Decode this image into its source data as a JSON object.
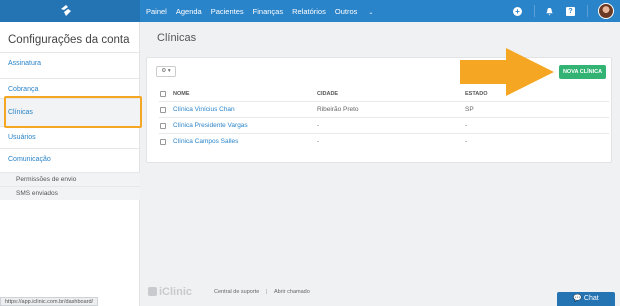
{
  "nav": {
    "items": [
      "Painel",
      "Agenda",
      "Pacientes",
      "Finanças",
      "Relatórios",
      "Outros"
    ],
    "chevron": "⌄"
  },
  "top_icons": {
    "plus": "+",
    "help": "?"
  },
  "sidebar": {
    "title": "Configurações da conta",
    "items": {
      "assinatura": "Assinatura",
      "cobranca": "Cobrança",
      "clinicas": "Clínicas",
      "usuarios": "Usuários",
      "comunicacao": "Comunicação"
    },
    "subitems": {
      "permissoes": "Permissões de envio",
      "sms": "SMS enviados"
    }
  },
  "main": {
    "title": "Clínicas",
    "new_button": "NOVA CLÍNICA",
    "tool_button": "⚙ ▾",
    "headers": {
      "nome": "NOME",
      "cidade": "CIDADE",
      "estado": "ESTADO"
    },
    "rows": [
      {
        "nome": "Clínica Vinícius Chan",
        "cidade": "Ribeirão Preto",
        "estado": "SP"
      },
      {
        "nome": "Clínica Presidente Vargas",
        "cidade": "-",
        "estado": "-"
      },
      {
        "nome": "Clínica Campos Salles",
        "cidade": "-",
        "estado": "-"
      }
    ]
  },
  "footer": {
    "logo_text": "iClinic",
    "suporte": "Central de suporte",
    "divider": "|",
    "chamado": "Abrir chamado",
    "url": "https://app.iclinic.com.br/dashboard/",
    "chat": "💬 Chat"
  },
  "colors": {
    "topbar": "#2a84c9",
    "accent_button": "#33b373",
    "highlight": "#f5a623"
  }
}
